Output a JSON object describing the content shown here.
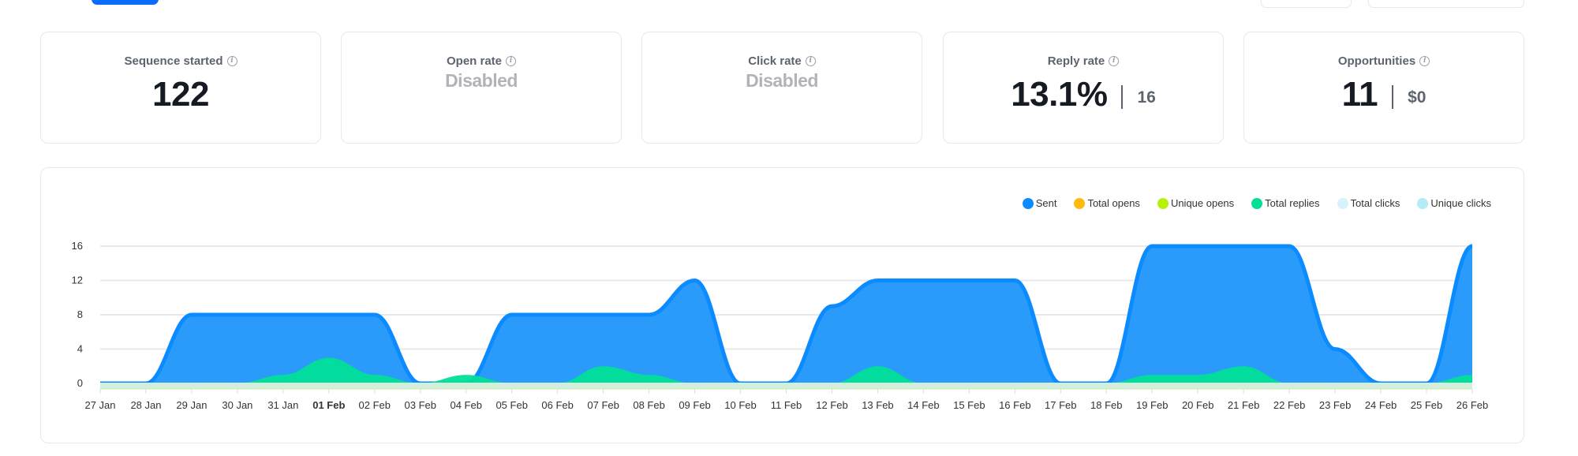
{
  "top_actions": {
    "primary_button": "",
    "outline_button_1": "",
    "outline_button_2": ""
  },
  "cards": [
    {
      "title": "Sequence started",
      "value": "122",
      "disabled": false,
      "sub": null
    },
    {
      "title": "Open rate",
      "value": "Disabled",
      "disabled": true,
      "sub": null
    },
    {
      "title": "Click rate",
      "value": "Disabled",
      "disabled": true,
      "sub": null
    },
    {
      "title": "Reply rate",
      "value": "13.1%",
      "disabled": false,
      "sub": "16"
    },
    {
      "title": "Opportunities",
      "value": "11",
      "disabled": false,
      "sub": "$0"
    }
  ],
  "info_icon_glyph": "i",
  "chart_data": {
    "type": "area",
    "title": "",
    "xlabel": "",
    "ylabel": "",
    "ylim": [
      0,
      16
    ],
    "yticks": [
      0,
      4,
      8,
      12,
      16
    ],
    "grid": true,
    "legend_position": "top-right",
    "highlighted_category": "01 Feb",
    "categories": [
      "27 Jan",
      "28 Jan",
      "29 Jan",
      "30 Jan",
      "31 Jan",
      "01 Feb",
      "02 Feb",
      "03 Feb",
      "04 Feb",
      "05 Feb",
      "06 Feb",
      "07 Feb",
      "08 Feb",
      "09 Feb",
      "10 Feb",
      "11 Feb",
      "12 Feb",
      "13 Feb",
      "14 Feb",
      "15 Feb",
      "16 Feb",
      "17 Feb",
      "18 Feb",
      "19 Feb",
      "20 Feb",
      "21 Feb",
      "22 Feb",
      "23 Feb",
      "24 Feb",
      "25 Feb",
      "26 Feb"
    ],
    "series": [
      {
        "name": "Sent",
        "color": "#0a8bff",
        "fill": "#2b9bfb",
        "values": [
          0,
          0,
          8,
          8,
          8,
          8,
          8,
          0,
          0,
          8,
          8,
          8,
          8,
          12,
          0,
          0,
          9,
          12,
          12,
          12,
          12,
          0,
          0,
          16,
          16,
          16,
          16,
          4,
          0,
          0,
          16
        ]
      },
      {
        "name": "Total opens",
        "color": "#ffbb0f",
        "fill": "#ffbb0f",
        "values": [
          0,
          0,
          0,
          0,
          0,
          0,
          0,
          0,
          0,
          0,
          0,
          0,
          0,
          0,
          0,
          0,
          0,
          0,
          0,
          0,
          0,
          0,
          0,
          0,
          0,
          0,
          0,
          0,
          0,
          0,
          0
        ]
      },
      {
        "name": "Unique opens",
        "color": "#b5f10a",
        "fill": "#b5f10a",
        "values": [
          0,
          0,
          0,
          0,
          0,
          0,
          0,
          0,
          0,
          0,
          0,
          0,
          0,
          0,
          0,
          0,
          0,
          0,
          0,
          0,
          0,
          0,
          0,
          0,
          0,
          0,
          0,
          0,
          0,
          0,
          0
        ]
      },
      {
        "name": "Total replies",
        "color": "#00df98",
        "fill": "#00df98",
        "values": [
          0,
          0,
          0,
          0,
          1,
          3,
          1,
          0,
          1,
          0,
          0,
          2,
          1,
          0,
          0,
          0,
          0,
          2,
          0,
          0,
          0,
          0,
          0,
          1,
          1,
          2,
          0,
          0,
          0,
          0,
          1
        ]
      },
      {
        "name": "Total clicks",
        "color": "#d6f3fc",
        "fill": "#d6f3fc",
        "values": [
          0,
          0,
          0,
          0,
          0,
          0,
          0,
          0,
          0,
          0,
          0,
          0,
          0,
          0,
          0,
          0,
          0,
          0,
          0,
          0,
          0,
          0,
          0,
          0,
          0,
          0,
          0,
          0,
          0,
          0,
          0
        ]
      },
      {
        "name": "Unique clicks",
        "color": "#b3ebf8",
        "fill": "#b3ebf8",
        "values": [
          0,
          0,
          0,
          0,
          0,
          0,
          0,
          0,
          0,
          0,
          0,
          0,
          0,
          0,
          0,
          0,
          0,
          0,
          0,
          0,
          0,
          0,
          0,
          0,
          0,
          0,
          0,
          0,
          0,
          0,
          0
        ]
      }
    ]
  }
}
